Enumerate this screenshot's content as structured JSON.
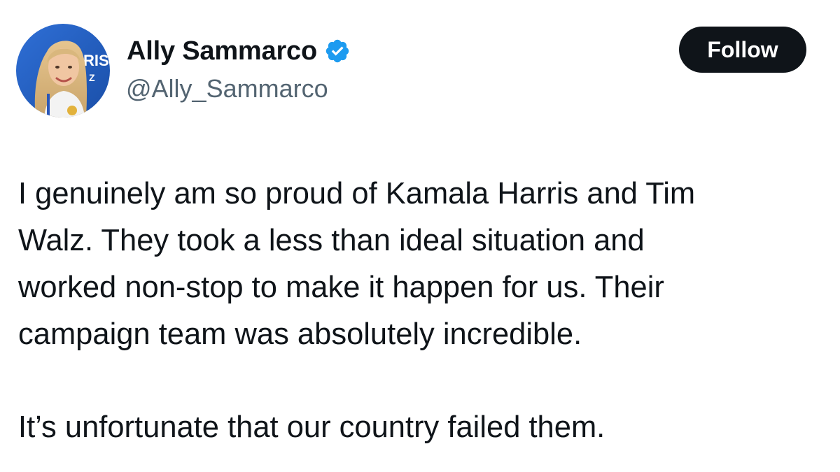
{
  "author": {
    "display_name": "Ally Sammarco",
    "handle": "@Ally_Sammarco",
    "verified": true,
    "avatar_icon": "profile-photo",
    "avatar_text": "RIS",
    "avatar_text_2": "Z"
  },
  "follow_button": {
    "label": "Follow"
  },
  "tweet": {
    "lines": [
      "I genuinely am so proud of Kamala Harris and Tim",
      "Walz. They took a less than ideal situation and",
      "worked non-stop to make it happen for us. Their",
      "campaign team was absolutely incredible."
    ],
    "second_paragraph": "It’s unfortunate that our country failed them."
  },
  "colors": {
    "text_primary": "#0f1419",
    "text_secondary": "#536471",
    "verified_blue": "#1d9bf0",
    "button_bg": "#0f1419",
    "button_text": "#ffffff"
  }
}
